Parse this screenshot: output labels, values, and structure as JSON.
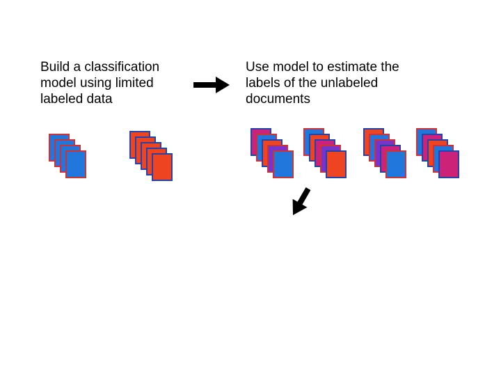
{
  "text": {
    "left": "Build a classification model using limited labeled data",
    "right": "Use model to estimate the labels of the unlabeled documents"
  },
  "colors": {
    "blue": "#2277dd",
    "red": "#ee4422",
    "magenta": "#cc2277",
    "purple": "#7733cc"
  },
  "diagram": {
    "left_stacks": [
      {
        "color": "blue",
        "count": 4
      },
      {
        "color": "red",
        "count": 5
      }
    ],
    "right_stacks": [
      {
        "colors": [
          "magenta",
          "blue",
          "red",
          "purple",
          "blue"
        ]
      },
      {
        "colors": [
          "blue",
          "red",
          "magenta",
          "purple",
          "red"
        ]
      },
      {
        "colors": [
          "red",
          "blue",
          "purple",
          "magenta",
          "blue"
        ]
      },
      {
        "colors": [
          "blue",
          "magenta",
          "red",
          "blue",
          "magenta"
        ]
      }
    ]
  }
}
